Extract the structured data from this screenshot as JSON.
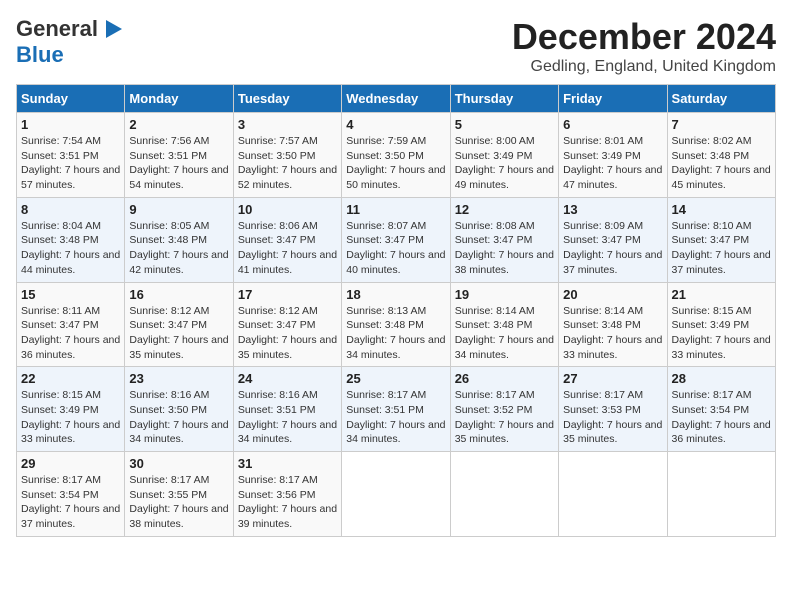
{
  "header": {
    "logo_general": "General",
    "logo_blue": "Blue",
    "month_title": "December 2024",
    "subtitle": "Gedling, England, United Kingdom"
  },
  "days_of_week": [
    "Sunday",
    "Monday",
    "Tuesday",
    "Wednesday",
    "Thursday",
    "Friday",
    "Saturday"
  ],
  "weeks": [
    [
      {
        "day": "1",
        "sunrise": "Sunrise: 7:54 AM",
        "sunset": "Sunset: 3:51 PM",
        "daylight": "Daylight: 7 hours and 57 minutes."
      },
      {
        "day": "2",
        "sunrise": "Sunrise: 7:56 AM",
        "sunset": "Sunset: 3:51 PM",
        "daylight": "Daylight: 7 hours and 54 minutes."
      },
      {
        "day": "3",
        "sunrise": "Sunrise: 7:57 AM",
        "sunset": "Sunset: 3:50 PM",
        "daylight": "Daylight: 7 hours and 52 minutes."
      },
      {
        "day": "4",
        "sunrise": "Sunrise: 7:59 AM",
        "sunset": "Sunset: 3:50 PM",
        "daylight": "Daylight: 7 hours and 50 minutes."
      },
      {
        "day": "5",
        "sunrise": "Sunrise: 8:00 AM",
        "sunset": "Sunset: 3:49 PM",
        "daylight": "Daylight: 7 hours and 49 minutes."
      },
      {
        "day": "6",
        "sunrise": "Sunrise: 8:01 AM",
        "sunset": "Sunset: 3:49 PM",
        "daylight": "Daylight: 7 hours and 47 minutes."
      },
      {
        "day": "7",
        "sunrise": "Sunrise: 8:02 AM",
        "sunset": "Sunset: 3:48 PM",
        "daylight": "Daylight: 7 hours and 45 minutes."
      }
    ],
    [
      {
        "day": "8",
        "sunrise": "Sunrise: 8:04 AM",
        "sunset": "Sunset: 3:48 PM",
        "daylight": "Daylight: 7 hours and 44 minutes."
      },
      {
        "day": "9",
        "sunrise": "Sunrise: 8:05 AM",
        "sunset": "Sunset: 3:48 PM",
        "daylight": "Daylight: 7 hours and 42 minutes."
      },
      {
        "day": "10",
        "sunrise": "Sunrise: 8:06 AM",
        "sunset": "Sunset: 3:47 PM",
        "daylight": "Daylight: 7 hours and 41 minutes."
      },
      {
        "day": "11",
        "sunrise": "Sunrise: 8:07 AM",
        "sunset": "Sunset: 3:47 PM",
        "daylight": "Daylight: 7 hours and 40 minutes."
      },
      {
        "day": "12",
        "sunrise": "Sunrise: 8:08 AM",
        "sunset": "Sunset: 3:47 PM",
        "daylight": "Daylight: 7 hours and 38 minutes."
      },
      {
        "day": "13",
        "sunrise": "Sunrise: 8:09 AM",
        "sunset": "Sunset: 3:47 PM",
        "daylight": "Daylight: 7 hours and 37 minutes."
      },
      {
        "day": "14",
        "sunrise": "Sunrise: 8:10 AM",
        "sunset": "Sunset: 3:47 PM",
        "daylight": "Daylight: 7 hours and 37 minutes."
      }
    ],
    [
      {
        "day": "15",
        "sunrise": "Sunrise: 8:11 AM",
        "sunset": "Sunset: 3:47 PM",
        "daylight": "Daylight: 7 hours and 36 minutes."
      },
      {
        "day": "16",
        "sunrise": "Sunrise: 8:12 AM",
        "sunset": "Sunset: 3:47 PM",
        "daylight": "Daylight: 7 hours and 35 minutes."
      },
      {
        "day": "17",
        "sunrise": "Sunrise: 8:12 AM",
        "sunset": "Sunset: 3:47 PM",
        "daylight": "Daylight: 7 hours and 35 minutes."
      },
      {
        "day": "18",
        "sunrise": "Sunrise: 8:13 AM",
        "sunset": "Sunset: 3:48 PM",
        "daylight": "Daylight: 7 hours and 34 minutes."
      },
      {
        "day": "19",
        "sunrise": "Sunrise: 8:14 AM",
        "sunset": "Sunset: 3:48 PM",
        "daylight": "Daylight: 7 hours and 34 minutes."
      },
      {
        "day": "20",
        "sunrise": "Sunrise: 8:14 AM",
        "sunset": "Sunset: 3:48 PM",
        "daylight": "Daylight: 7 hours and 33 minutes."
      },
      {
        "day": "21",
        "sunrise": "Sunrise: 8:15 AM",
        "sunset": "Sunset: 3:49 PM",
        "daylight": "Daylight: 7 hours and 33 minutes."
      }
    ],
    [
      {
        "day": "22",
        "sunrise": "Sunrise: 8:15 AM",
        "sunset": "Sunset: 3:49 PM",
        "daylight": "Daylight: 7 hours and 33 minutes."
      },
      {
        "day": "23",
        "sunrise": "Sunrise: 8:16 AM",
        "sunset": "Sunset: 3:50 PM",
        "daylight": "Daylight: 7 hours and 34 minutes."
      },
      {
        "day": "24",
        "sunrise": "Sunrise: 8:16 AM",
        "sunset": "Sunset: 3:51 PM",
        "daylight": "Daylight: 7 hours and 34 minutes."
      },
      {
        "day": "25",
        "sunrise": "Sunrise: 8:17 AM",
        "sunset": "Sunset: 3:51 PM",
        "daylight": "Daylight: 7 hours and 34 minutes."
      },
      {
        "day": "26",
        "sunrise": "Sunrise: 8:17 AM",
        "sunset": "Sunset: 3:52 PM",
        "daylight": "Daylight: 7 hours and 35 minutes."
      },
      {
        "day": "27",
        "sunrise": "Sunrise: 8:17 AM",
        "sunset": "Sunset: 3:53 PM",
        "daylight": "Daylight: 7 hours and 35 minutes."
      },
      {
        "day": "28",
        "sunrise": "Sunrise: 8:17 AM",
        "sunset": "Sunset: 3:54 PM",
        "daylight": "Daylight: 7 hours and 36 minutes."
      }
    ],
    [
      {
        "day": "29",
        "sunrise": "Sunrise: 8:17 AM",
        "sunset": "Sunset: 3:54 PM",
        "daylight": "Daylight: 7 hours and 37 minutes."
      },
      {
        "day": "30",
        "sunrise": "Sunrise: 8:17 AM",
        "sunset": "Sunset: 3:55 PM",
        "daylight": "Daylight: 7 hours and 38 minutes."
      },
      {
        "day": "31",
        "sunrise": "Sunrise: 8:17 AM",
        "sunset": "Sunset: 3:56 PM",
        "daylight": "Daylight: 7 hours and 39 minutes."
      },
      null,
      null,
      null,
      null
    ]
  ]
}
